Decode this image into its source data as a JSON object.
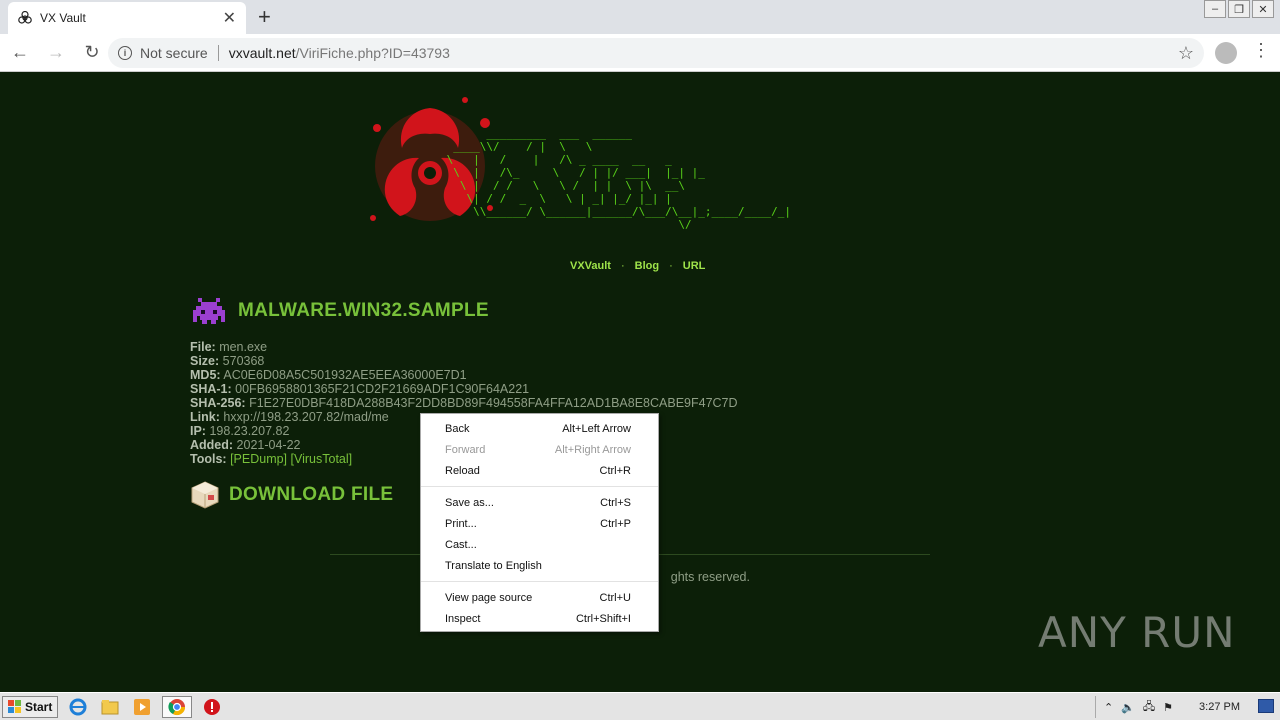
{
  "browser": {
    "tab_title": "VX Vault",
    "tab_close": "✕",
    "new_tab": "+",
    "security_text": "Not secure",
    "url_host": "vxvault.net",
    "url_path": "/ViriFiche.php?ID=43793"
  },
  "page": {
    "ascii_logo": "       _________  ___  ______\n  ____\\\\/    / |  \\   \\\n \\   |   /    |   /\\ _ ____  __   _\n  \\  |   /\\_     \\   / | |/ ___|  |_| |_\n   \\ |  / /   \\   \\ /  | |  \\ |\\  __\\\n    \\| / /  _  \\   \\ | _| |_/ |_| |\n     \\\\______/ \\______|______/\\___/\\__|_;____/____/_|\n                                    \\/",
    "nav": [
      "VXVault",
      "Blog",
      "URL"
    ],
    "nav_dot": "·",
    "sample_title": "MALWARE.WIN32.SAMPLE",
    "meta": {
      "file_label": "File:",
      "file": "men.exe",
      "size_label": "Size:",
      "size": "570368",
      "md5_label": "MD5:",
      "md5": "AC0E6D08A5C501932AE5EEA36000E7D1",
      "sha1_label": "SHA-1:",
      "sha1": "00FB6958801365F21CD2F21669ADF1C90F64A221",
      "sha256_label": "SHA-256:",
      "sha256": "F1E27E0DBF418DA288B43F2DD8BD89F494558FA4FFA12AD1BA8E8CABE9F47C7D",
      "link_label": "Link:",
      "link": "hxxp://198.23.207.82/mad/me",
      "ip_label": "IP:",
      "ip": "198.23.207.82",
      "added_label": "Added:",
      "added": "2021-04-22",
      "tools_label": "Tools:",
      "tool1": "[PEDump]",
      "tool2": "[VirusTotal]"
    },
    "download_label": "DOWNLOAD FILE",
    "footer_fragment": "ghts reserved."
  },
  "context_menu": {
    "items": [
      {
        "label": "Back",
        "shortcut": "Alt+Left Arrow"
      },
      {
        "label": "Forward",
        "shortcut": "Alt+Right Arrow"
      },
      {
        "label": "Reload",
        "shortcut": "Ctrl+R"
      },
      {
        "label": "Save as...",
        "shortcut": "Ctrl+S"
      },
      {
        "label": "Print...",
        "shortcut": "Ctrl+P"
      },
      {
        "label": "Cast...",
        "shortcut": ""
      },
      {
        "label": "Translate to English",
        "shortcut": ""
      },
      {
        "label": "View page source",
        "shortcut": "Ctrl+U"
      },
      {
        "label": "Inspect",
        "shortcut": "Ctrl+Shift+I"
      }
    ]
  },
  "watermark": "ANY RUN",
  "taskbar": {
    "start_label": "Start",
    "clock": "3:27 PM"
  },
  "colors": {
    "page_bg": "#0c1f08",
    "accent_green": "#78c13a",
    "ascii_green": "#59d11a",
    "splat_red": "#d1141b"
  }
}
